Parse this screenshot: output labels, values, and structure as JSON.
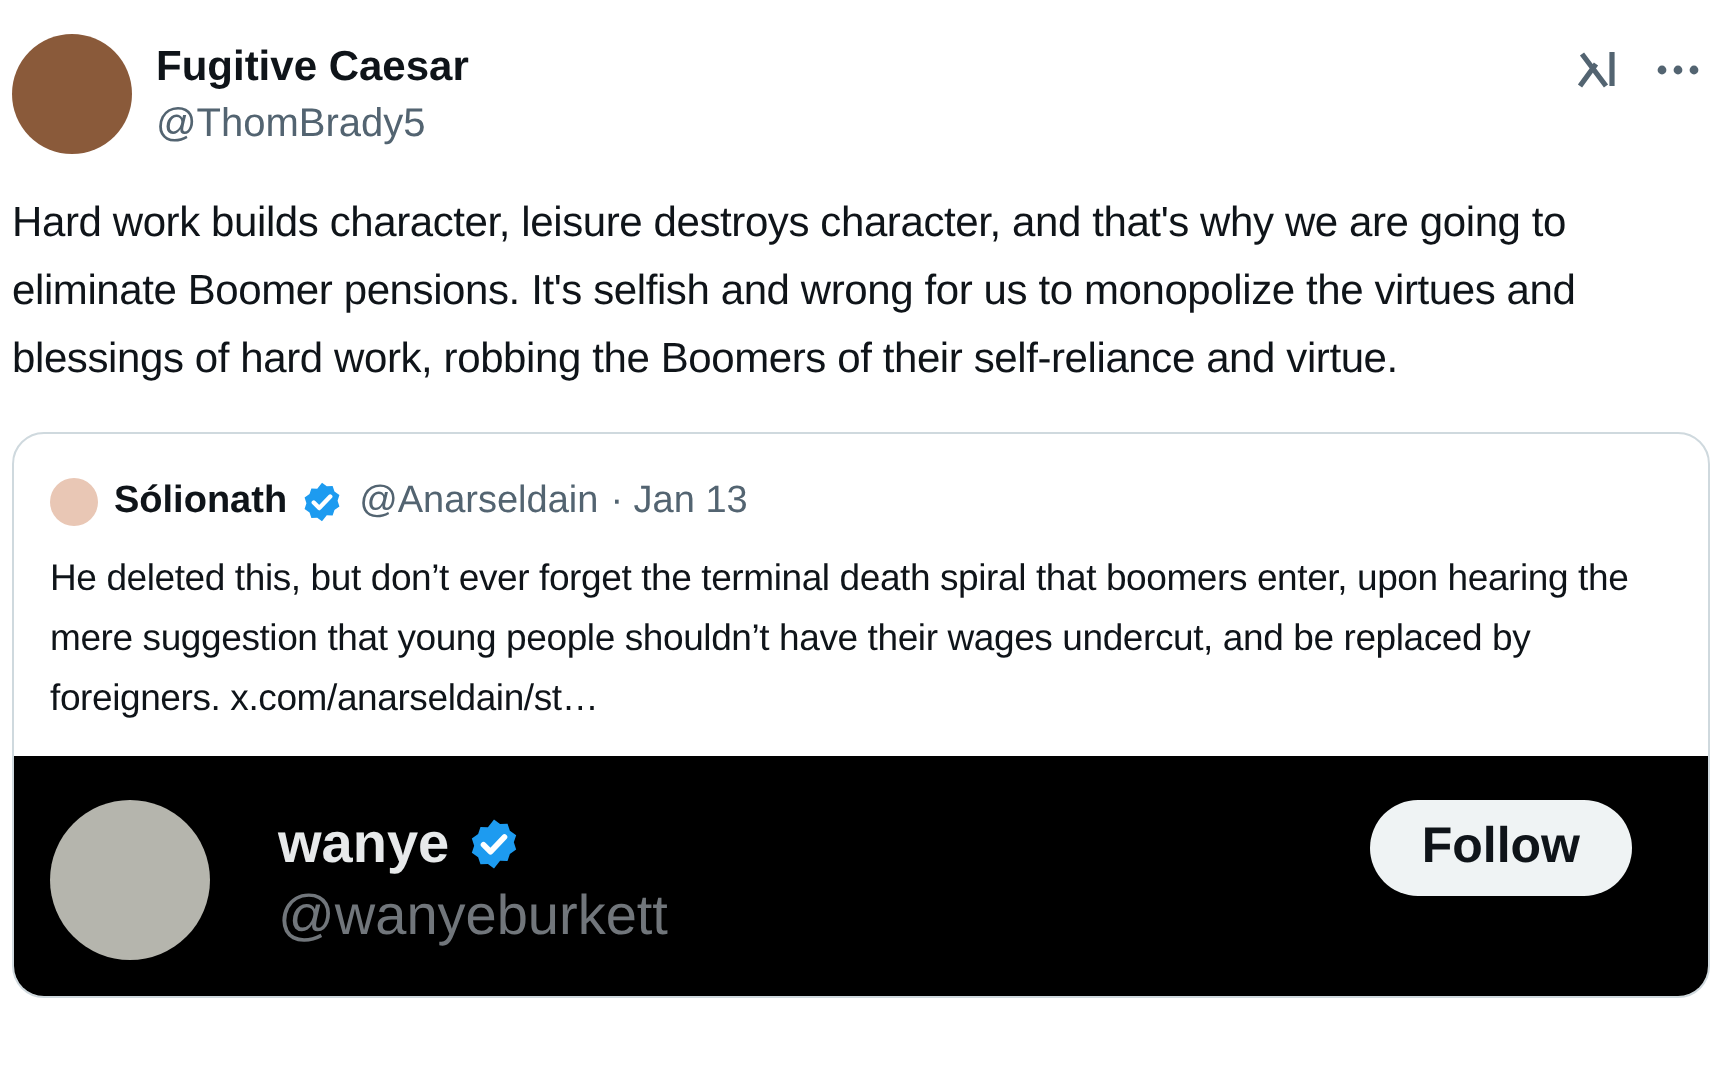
{
  "author": {
    "name": "Fugitive Caesar",
    "handle": "@ThomBrady5"
  },
  "body": "Hard work builds character, leisure destroys character, and that's why we are going to eliminate Boomer pensions. It's selfish and wrong for us to monopolize the virtues and blessings of hard work, robbing the Boomers of their self-reliance and virtue.",
  "quote": {
    "name": "Sólionath",
    "verified": true,
    "handle": "@Anarseldain",
    "date": "· Jan 13",
    "text": "He deleted this, but don’t ever forget the terminal death spiral that boomers enter, upon hearing the mere suggestion that young people shouldn’t have their wages undercut, and be replaced by foreigners.",
    "link": "x.com/anarseldain/st…",
    "embed": {
      "name": "wanye",
      "verified": true,
      "handle": "@wanyeburkett",
      "button": "Follow"
    }
  }
}
